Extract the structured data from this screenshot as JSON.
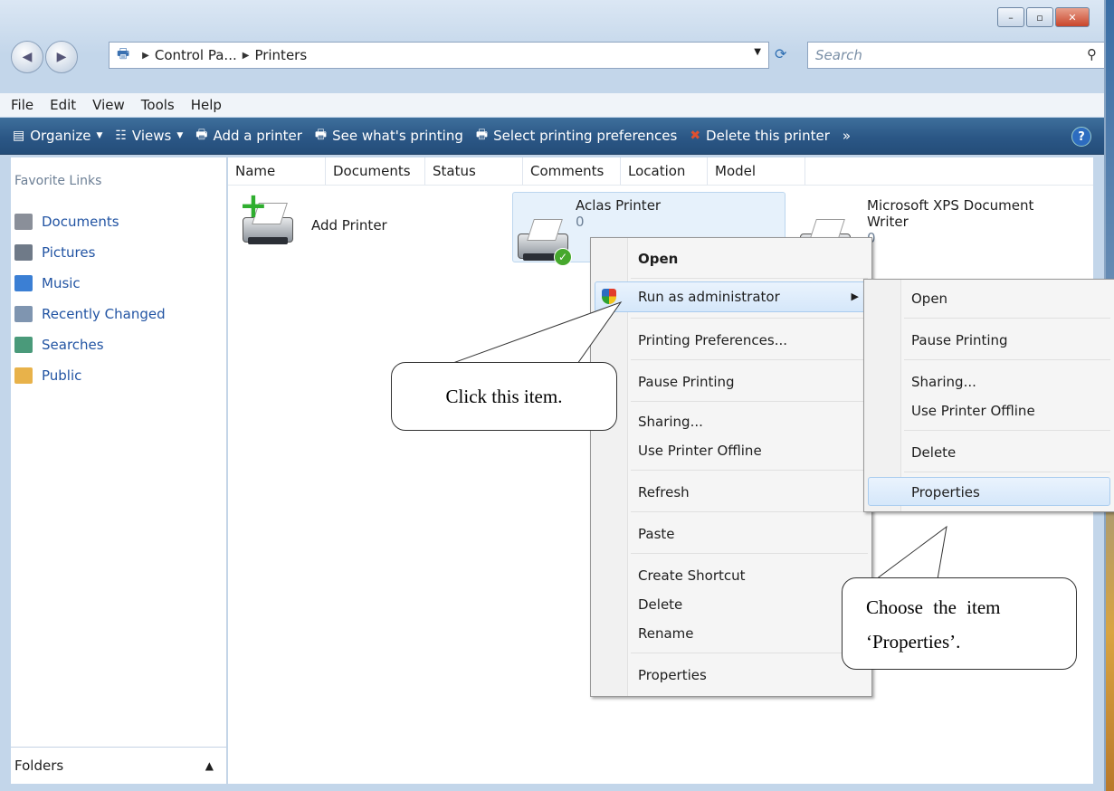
{
  "window": {
    "minimize": "–",
    "maximize": "▫",
    "close": "✕"
  },
  "nav": {
    "back_glyph": "◀",
    "forward_glyph": "▶",
    "breadcrumb": [
      "Control Pa...",
      "Printers"
    ],
    "search_placeholder": "Search"
  },
  "menubar": [
    "File",
    "Edit",
    "View",
    "Tools",
    "Help"
  ],
  "toolbar": [
    {
      "label": "Organize",
      "icon": "organize-icon",
      "dropdown": true
    },
    {
      "label": "Views",
      "icon": "views-icon",
      "dropdown": true
    },
    {
      "label": "Add a printer",
      "icon": "add-printer-icon",
      "dropdown": false
    },
    {
      "label": "See what's printing",
      "icon": "printer-queue-icon",
      "dropdown": false
    },
    {
      "label": "Select printing preferences",
      "icon": "preferences-icon",
      "dropdown": false
    },
    {
      "label": "Delete this printer",
      "icon": "delete-icon",
      "dropdown": false
    },
    {
      "label": "»",
      "icon": "overflow-icon",
      "dropdown": false
    }
  ],
  "sidebar": {
    "heading": "Favorite Links",
    "links": [
      {
        "label": "Documents",
        "icon": "documents-icon",
        "color": "#8a8f99"
      },
      {
        "label": "Pictures",
        "icon": "pictures-icon",
        "color": "#6f7a88"
      },
      {
        "label": "Music",
        "icon": "music-icon",
        "color": "#3b7fd4"
      },
      {
        "label": "Recently Changed",
        "icon": "recently-changed-icon",
        "color": "#7f95b0"
      },
      {
        "label": "Searches",
        "icon": "searches-icon",
        "color": "#4a9a7a"
      },
      {
        "label": "Public",
        "icon": "public-folder-icon",
        "color": "#e8b24a"
      }
    ],
    "folders_label": "Folders"
  },
  "columns": [
    "Name",
    "Documents",
    "Status",
    "Comments",
    "Location",
    "Model"
  ],
  "printers": [
    {
      "name": "Add Printer",
      "count": ""
    },
    {
      "name": "Aclas Printer",
      "count": "0"
    },
    {
      "name_line1": "Microsoft XPS Document",
      "name_line2": "Writer",
      "count": "0"
    }
  ],
  "context_menu": {
    "open": "Open",
    "run_as_admin": "Run as administrator",
    "items": [
      "Printing Preferences...",
      "Pause Printing",
      "Sharing...",
      "Use Printer Offline",
      "Refresh",
      "Paste",
      "Create Shortcut",
      "Delete",
      "Rename",
      "Properties"
    ]
  },
  "submenu": {
    "items": [
      "Open",
      "Pause Printing",
      "Sharing...",
      "Use Printer Offline",
      "Delete",
      "Properties"
    ]
  },
  "callouts": {
    "first": "Click this item.",
    "second_line1": "Choose the item",
    "second_line2": "‘Properties’."
  }
}
